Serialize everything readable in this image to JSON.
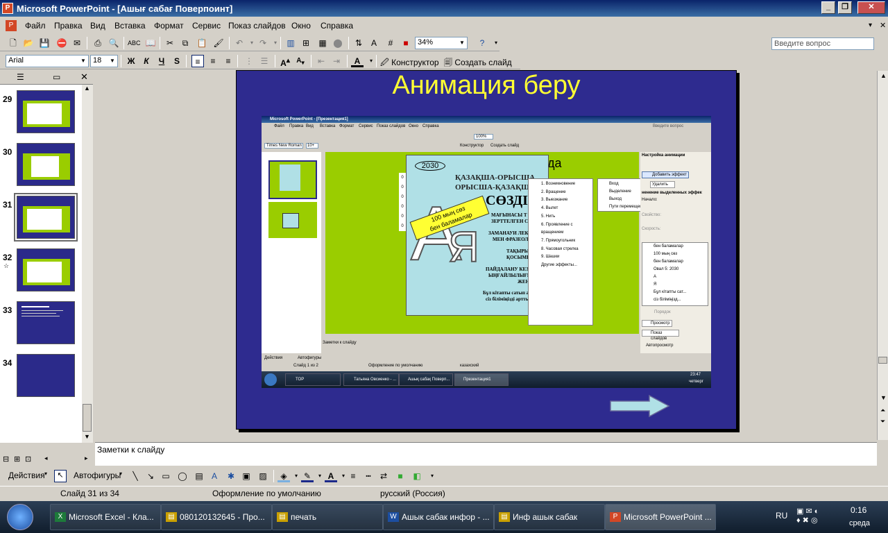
{
  "window": {
    "title": "Microsoft PowerPoint - [Ашығ сабағ Поверпоинт]"
  },
  "menu": [
    "Файл",
    "Правка",
    "Вид",
    "Вставка",
    "Формат",
    "Сервис",
    "Показ слайдов",
    "Окно",
    "Справка"
  ],
  "question_placeholder": "Введите вопрос",
  "zoom": "34%",
  "font": {
    "name": "Arial",
    "size": "18"
  },
  "format_buttons": {
    "bold": "Ж",
    "italic": "К",
    "underline": "Ч",
    "shadow": "S"
  },
  "toolbar": {
    "designer": "Конструктор",
    "new_slide": "Создать слайд"
  },
  "slides": [
    {
      "num": "29"
    },
    {
      "num": "30"
    },
    {
      "num": "31"
    },
    {
      "num": "32"
    },
    {
      "num": "33"
    },
    {
      "num": "34"
    }
  ],
  "slide": {
    "title": "Анимация беру",
    "inner": {
      "title": "Microsoft PowerPoint - [Презентация1]",
      "menu": [
        "Файл",
        "Правка",
        "Вид",
        "Вставка",
        "Формат",
        "Сервис",
        "Показ слайдов",
        "Окно",
        "Справка"
      ],
      "question": "Введите вопрос",
      "font": "Times New Roman",
      "size": "10+",
      "zoom": "100%",
      "designer": "Конструктор",
      "new_slide": "Создать слайд",
      "year": "2030",
      "heading1": "ҚАЗАҚША-ОРЫСША",
      "heading2": "ОРЫСША-ҚАЗАҚША",
      "heading3": "СӨЗДІГІ",
      "text1": "МАҒЫНАСЫ Т",
      "text2": "ЗЕРТТЕЛГЕН С",
      "text3": "ЗАМАНАУИ ЛЕК",
      "text4": "МЕН ФРАЗЕОЛ",
      "text5": "ТАҚЫРЫ",
      "text6": "ҚОСЫМШ",
      "text7": "ПАЙДАЛАНУ КЕЗІНДЕГІ",
      "text8": "ЫҢҒАЙЛЫЛЫҒЫ МЕН",
      "text9": "ЖЕҢІЛДІГІ",
      "text10": "Бұл кітапты сатып алсаңыз,",
      "text11": "сіз біліміңізді арттырасыз!!!",
      "banner1": "100 мың сөз",
      "banner2": "бен баламалар",
      "bg_word": "да",
      "submenu": [
        "Вход",
        "Выделение",
        "Выход",
        "Пути перемещения"
      ],
      "effects": [
        "1. Возникновение",
        "2. Вращение",
        "3. Выезжание",
        "4. Вылет",
        "5. Нить",
        "6. Проявление с вращением",
        "7. Прямоугольник",
        "8. Часовая стрелка",
        "9. Шашки",
        "Другие эффекты..."
      ],
      "panel_title": "Настройка анимации",
      "add_effect": "Добавить эффект",
      "delete": "Удалить",
      "change": "ненение выделенных эффек",
      "start": "Начало:",
      "property": "Свойство:",
      "speed": "Скорость:",
      "anim_list": [
        "бен баламалар",
        "100 мың сөз",
        "бен баламалар",
        "Овал 5: 2030",
        "А",
        "Я",
        "Бұл кітапты сат...",
        "сіз біліміңізд..."
      ],
      "order": "Порядок",
      "view": "Просмотр",
      "show": "Показ слайдов",
      "autopreview": "Автопросмотр",
      "notes": "Заметки к слайду",
      "status": [
        "Слайд 1 из 2",
        "Оформление по умолчанию",
        "казахский"
      ],
      "actions": "Действия",
      "autoshapes": "Автофигуры",
      "tasks": [
        "TOP",
        "Татьяна Овсиенко - ...",
        "Ашық сабақ Поверп...",
        "Презентация1"
      ],
      "clock_time": "23:47",
      "clock_day": "четверг"
    }
  },
  "notes": {
    "text": "Заметки к слайду"
  },
  "draw": {
    "actions": "Действия",
    "autoshapes": "Автофигуры"
  },
  "status": {
    "slide": "Слайд 31 из 34",
    "design": "Оформление по умолчанию",
    "lang": "русский (Россия)"
  },
  "taskbar": {
    "tasks": [
      "Microsoft Excel - Кла...",
      "080120132645 - Про...",
      "печать",
      "Ашык сабак инфор - ...",
      "Инф ашык сабак",
      "Microsoft PowerPoint ..."
    ],
    "lang": "RU",
    "time": "0:16",
    "day": "среда"
  }
}
